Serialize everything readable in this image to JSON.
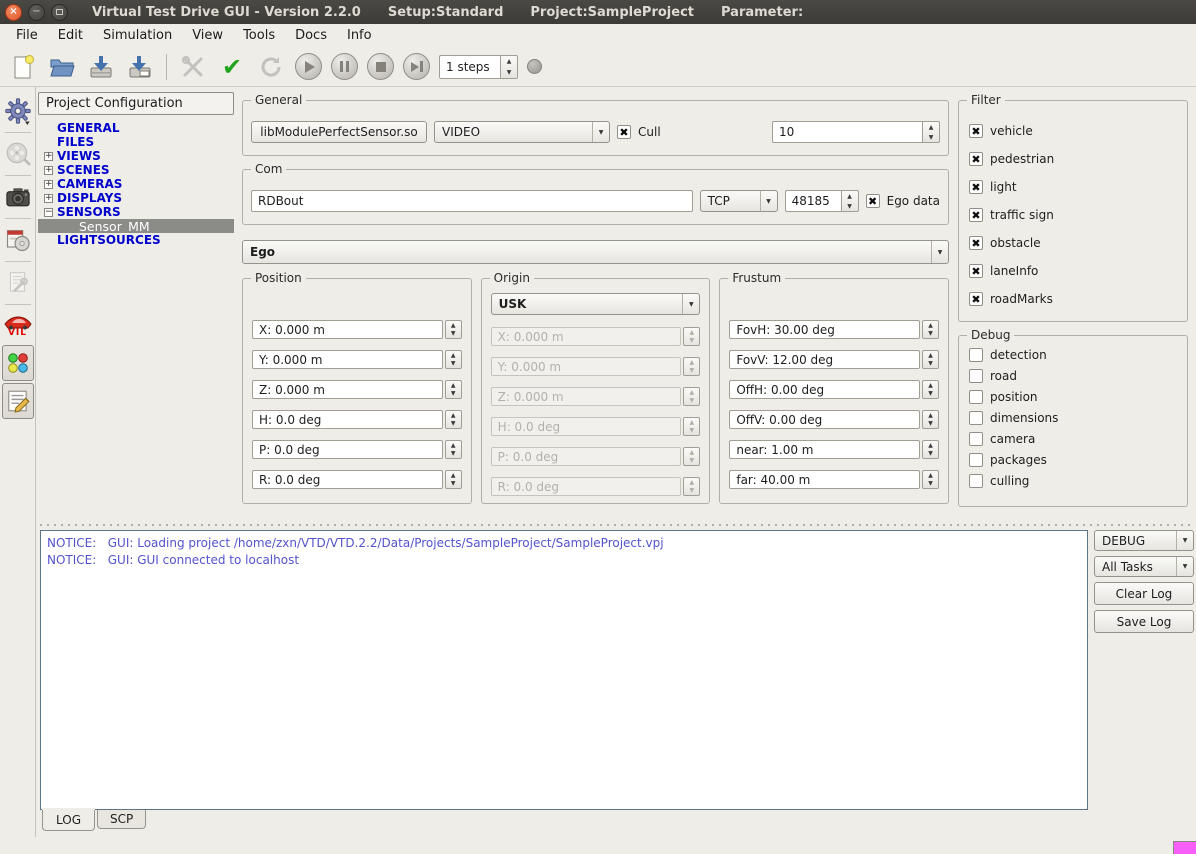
{
  "colors": {
    "titlebar_bg": "#3c3b37",
    "close_button": "#e2592f",
    "tree_link": "#0000cc",
    "selected_bg": "#8b8b87",
    "log_text": "#5353cd",
    "check_green": "#23a41e",
    "size_grip": "#f85ef8",
    "folder_blue": "#6f93c2"
  },
  "window": {
    "title_parts": [
      "Virtual Test Drive GUI - Version 2.2.0",
      "Setup:Standard",
      "Project:SampleProject",
      "Parameter:"
    ],
    "buttons": [
      "close",
      "minimize",
      "maximize"
    ]
  },
  "menubar": {
    "items": [
      "File",
      "Edit",
      "Simulation",
      "View",
      "Tools",
      "Docs",
      "Info"
    ]
  },
  "toolbar": {
    "steps": "1 steps",
    "icons": [
      "new-file",
      "open-project",
      "save",
      "save-as",
      "tools",
      "validate",
      "refresh",
      "play",
      "pause",
      "stop",
      "step-forward",
      "status-led"
    ]
  },
  "rail": {
    "icons": [
      "settings-gear",
      "film-reel",
      "camera",
      "package-cd",
      "config-wrench",
      "vil-car",
      "traffic-lights",
      "notepad"
    ],
    "vil_label": "VIL"
  },
  "tree": {
    "header": "Project Configuration",
    "items": [
      {
        "label": "GENERAL"
      },
      {
        "label": "FILES"
      },
      {
        "label": "VIEWS",
        "expand": "plus"
      },
      {
        "label": "SCENES",
        "expand": "plus"
      },
      {
        "label": "CAMERAS",
        "expand": "plus"
      },
      {
        "label": "DISPLAYS",
        "expand": "plus"
      },
      {
        "label": "SENSORS",
        "expand": "minus"
      },
      {
        "label": "Sensor_MM",
        "child": true,
        "selected": true
      },
      {
        "label": "LIGHTSOURCES"
      }
    ]
  },
  "general": {
    "title": "General",
    "module_button": "libModulePerfectSensor.so",
    "mode_select": "VIDEO",
    "cull": {
      "label": "Cull",
      "checked": true
    },
    "count_spin": "10"
  },
  "com": {
    "title": "Com",
    "channel_input": "RDBout",
    "protocol_select": "TCP",
    "port_spin": "48185",
    "ego_data": {
      "label": "Ego data",
      "checked": true
    }
  },
  "ego": {
    "select": "Ego"
  },
  "position": {
    "title": "Position",
    "disabled": false,
    "fields": [
      "X: 0.000 m",
      "Y: 0.000 m",
      "Z: 0.000 m",
      "H: 0.0 deg",
      "P: 0.0 deg",
      "R: 0.0 deg"
    ]
  },
  "origin": {
    "title": "Origin",
    "select": "USK",
    "disabled": true,
    "fields": [
      "X: 0.000 m",
      "Y: 0.000 m",
      "Z: 0.000 m",
      "H: 0.0 deg",
      "P: 0.0 deg",
      "R: 0.0 deg"
    ]
  },
  "frustum": {
    "title": "Frustum",
    "disabled": false,
    "fields": [
      "FovH: 30.00 deg",
      "FovV: 12.00 deg",
      "OffH: 0.00 deg",
      "OffV: 0.00 deg",
      "near: 1.00 m",
      "far: 40.00 m"
    ]
  },
  "filter": {
    "title": "Filter",
    "items": [
      {
        "label": "vehicle",
        "checked": true
      },
      {
        "label": "pedestrian",
        "checked": true
      },
      {
        "label": "light",
        "checked": true
      },
      {
        "label": "traffic sign",
        "checked": true
      },
      {
        "label": "obstacle",
        "checked": true
      },
      {
        "label": "laneInfo",
        "checked": true
      },
      {
        "label": "roadMarks",
        "checked": true
      }
    ]
  },
  "debug": {
    "title": "Debug",
    "items": [
      {
        "label": "detection",
        "checked": false
      },
      {
        "label": "road",
        "checked": false
      },
      {
        "label": "position",
        "checked": false
      },
      {
        "label": "dimensions",
        "checked": false
      },
      {
        "label": "camera",
        "checked": false
      },
      {
        "label": "packages",
        "checked": false
      },
      {
        "label": "culling",
        "checked": false
      }
    ]
  },
  "log": {
    "lines": [
      "NOTICE:   GUI: Loading project /home/zxn/VTD/VTD.2.2/Data/Projects/SampleProject/SampleProject.vpj",
      "NOTICE:   GUI: GUI connected to localhost"
    ],
    "level_select": "DEBUG",
    "tasks_select": "All Tasks",
    "clear_button": "Clear Log",
    "save_button": "Save Log",
    "tabs": [
      {
        "label": "LOG",
        "active": true
      },
      {
        "label": "SCP",
        "active": false
      }
    ]
  }
}
